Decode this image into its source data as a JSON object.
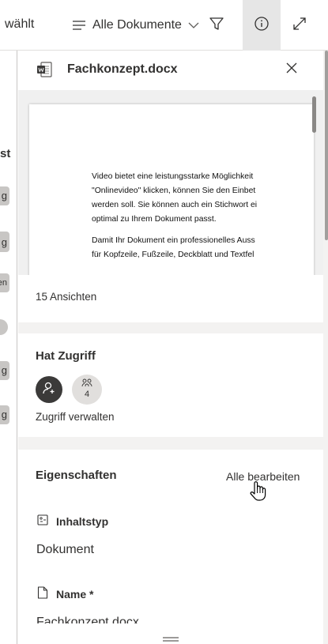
{
  "topbar": {
    "selected_text": "wählt",
    "view_label": "Alle Dokumente",
    "icons": [
      "list-icon",
      "chevron-down-icon",
      "filter-icon",
      "info-icon",
      "expand-icon"
    ]
  },
  "list": {
    "column_header": "st",
    "tags": [
      "g",
      "g",
      "g",
      "en",
      "g",
      "g"
    ]
  },
  "details": {
    "filename": "Fachkonzept.docx",
    "preview_lines": [
      "Video bietet eine leistungsstarke Möglichkeit",
      "\"Onlinevideo\" klicken, können Sie den Einbet",
      "werden soll. Sie können auch ein Stichwort ei",
      "optimal zu Ihrem Dokument passt.",
      "Damit Ihr Dokument ein professionelles Auss",
      "für Kopfzeile, Fußzeile, Deckblatt und Textfel"
    ],
    "views": "15 Ansichten",
    "access": {
      "title": "Hat Zugriff",
      "group_count": "4",
      "manage_label": "Zugriff verwalten"
    },
    "properties": {
      "title": "Eigenschaften",
      "edit_all": "Alle bearbeiten",
      "fields": [
        {
          "label": "Inhaltstyp",
          "value": "Dokument"
        },
        {
          "label": "Name *",
          "value": "Fachkonzept.docx"
        }
      ]
    }
  }
}
